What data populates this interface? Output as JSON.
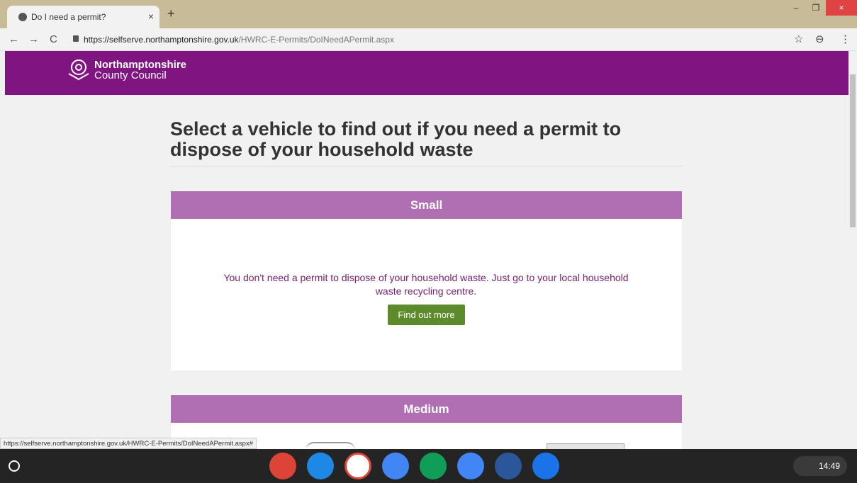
{
  "browser": {
    "tab_title": "Do I need a permit?",
    "tab_close": "×",
    "new_tab": "+",
    "url_host": "https://selfserve.northamptonshire.gov.uk",
    "url_path": "/HWRC-E-Permits/DoINeedAPermit.aspx",
    "back": "←",
    "forward": "→",
    "reload": "C",
    "star": "☆",
    "account": "⊖",
    "menu": "⋮",
    "minimize": "–",
    "restore": "❐",
    "close": "×",
    "status_url": "https://selfserve.northamptonshire.gov.uk/HWRC-E-Permits/DoINeedAPermit.aspx#"
  },
  "header": {
    "org_line1": "Northamptonshire",
    "org_line2": "County Council",
    "header_color": "#801481"
  },
  "main": {
    "title": "Select a vehicle to find out if you need a permit to dispose of your household waste",
    "cards": [
      {
        "heading": "Small",
        "message": "You don't need a permit to dispose of your household waste. Just go to your local household waste recycling centre.",
        "button": "Find out more"
      },
      {
        "heading": "Medium"
      }
    ],
    "card_header_color": "#b06fb3",
    "button_color": "#5d8a2b"
  },
  "shelf": {
    "apps": [
      {
        "name": "chrome-icon",
        "color": "#db4437"
      },
      {
        "name": "cyberlink-icon",
        "color": "#1e88e5"
      },
      {
        "name": "gmail-icon",
        "color": "#ffffff"
      },
      {
        "name": "docs-icon",
        "color": "#4285f4"
      },
      {
        "name": "hangouts-icon",
        "color": "#0f9d58"
      },
      {
        "name": "chrome-remote-icon",
        "color": "#4285f4"
      },
      {
        "name": "word-icon",
        "color": "#2b579a"
      },
      {
        "name": "files-icon",
        "color": "#1a73e8"
      }
    ],
    "time": "14:49"
  }
}
